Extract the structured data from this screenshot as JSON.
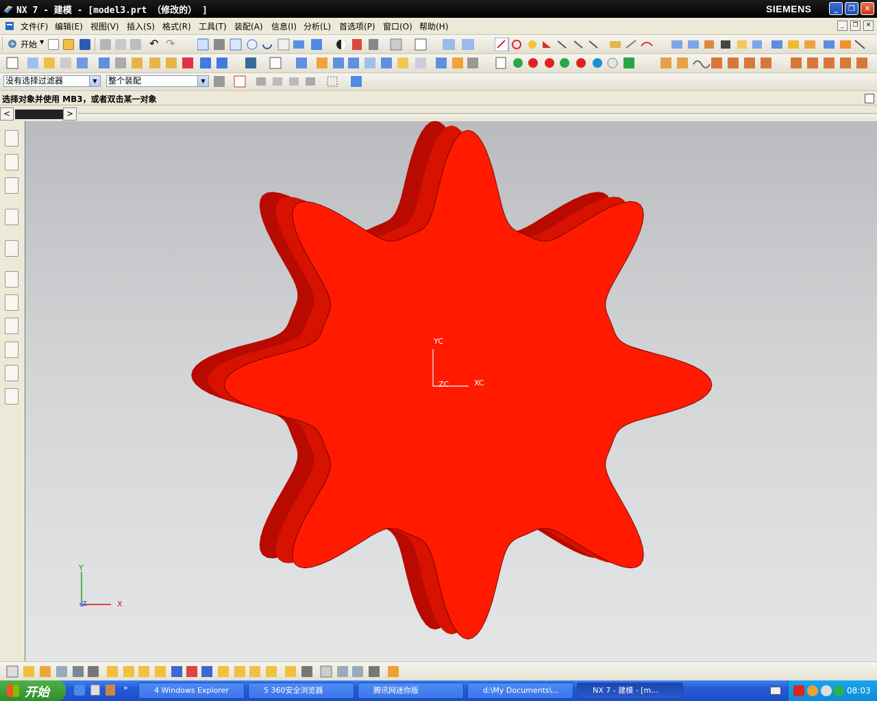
{
  "window": {
    "title": "NX 7 - 建模 - [model3.prt （修改的） ]",
    "brand": "SIEMENS",
    "minimize": "_",
    "restore": "❐",
    "close": "✕"
  },
  "menu": {
    "items": [
      "文件(F)",
      "编辑(E)",
      "视图(V)",
      "插入(S)",
      "格式(R)",
      "工具(T)",
      "装配(A)",
      "信息(I)",
      "分析(L)",
      "首选项(P)",
      "窗口(O)",
      "帮助(H)"
    ]
  },
  "toolbar": {
    "start_label": "开始",
    "filter_value": "没有选择过滤器",
    "assembly_value": "整个装配"
  },
  "status": {
    "prompt": "选择对象并使用 MB3，或者双击某一对象"
  },
  "viewport": {
    "wcs_y": "YC",
    "wcs_x": "XC",
    "wcs_z": "ZC",
    "abs_y": "Y",
    "abs_x": "X",
    "abs_z": "Z",
    "part_color": "#ff1a00",
    "part_shadow_color": "#b80a00",
    "part_tooth_count": 8
  },
  "scroll": {
    "left_arrow": "<",
    "right_arrow": ">"
  },
  "taskbar": {
    "start_label": "开始",
    "tasks": [
      "4 Windows Explorer",
      "5 360安全浏览器",
      "腾讯网迷你版",
      "d:\\My Documents\\...",
      "NX 7 - 建模 - [m..."
    ],
    "clock": "08:03"
  }
}
